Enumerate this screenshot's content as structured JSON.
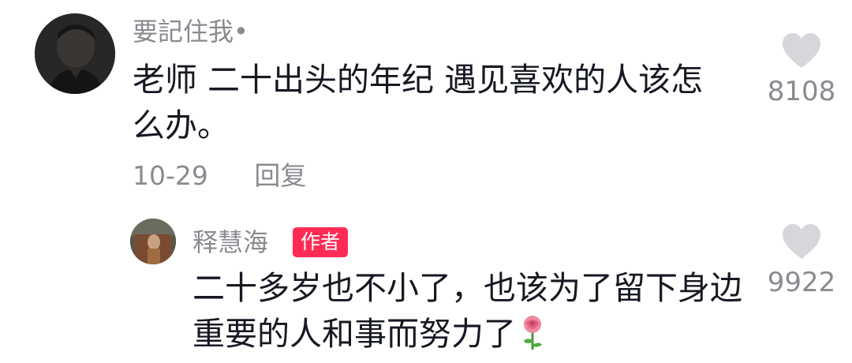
{
  "colors": {
    "text_primary": "#161823",
    "text_secondary": "#8a8b91",
    "heart_gray": "#d6d7da",
    "author_badge": "#fe2c55"
  },
  "comment": {
    "author": "要記住我•",
    "text": "老师 二十出头的年纪 遇见喜欢的人该怎么办。",
    "date": "10-29",
    "reply_label": "回复",
    "like_count": "8108",
    "like_icon": "heart-outline-icon"
  },
  "reply": {
    "author": "释慧海",
    "badge": "作者",
    "text": "二十多岁也不小了，也该为了留下身边重要的人和事而努力了",
    "emoji_icon": "rose-icon",
    "like_count": "9922",
    "like_icon": "heart-outline-icon"
  }
}
